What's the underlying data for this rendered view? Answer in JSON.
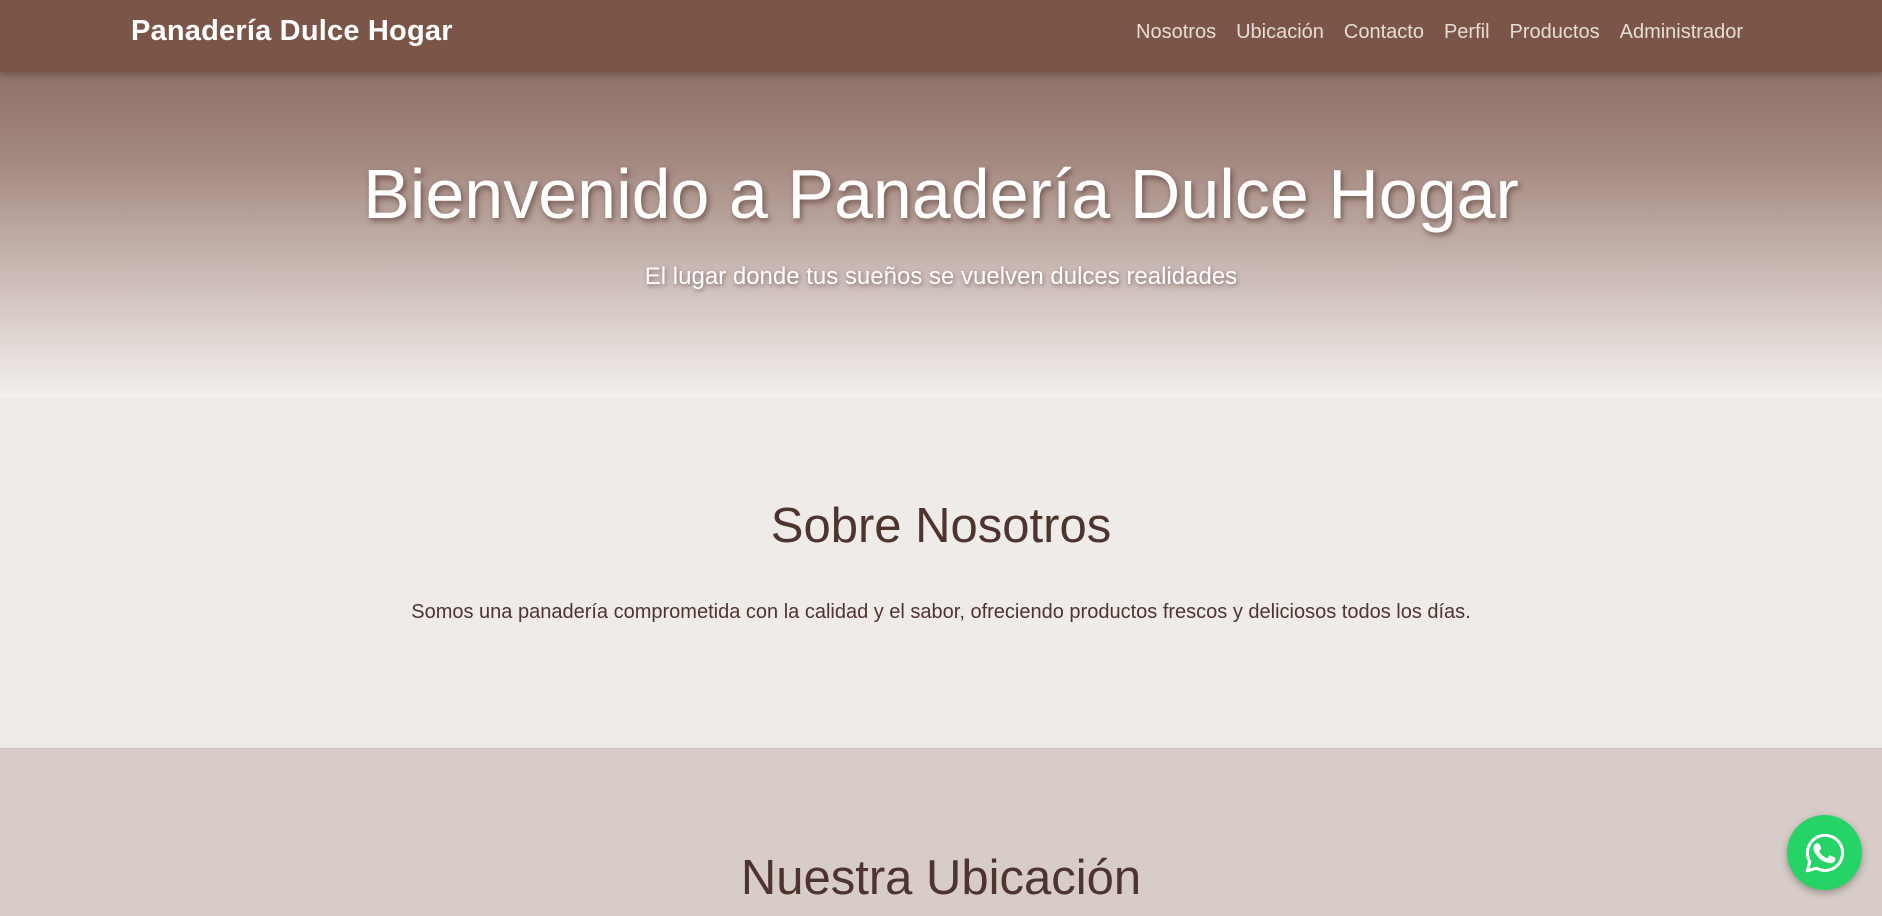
{
  "navbar": {
    "brand": "Panadería Dulce Hogar",
    "links": [
      {
        "label": "Nosotros"
      },
      {
        "label": "Ubicación"
      },
      {
        "label": "Contacto"
      },
      {
        "label": "Perfil"
      },
      {
        "label": "Productos"
      },
      {
        "label": "Administrador"
      }
    ]
  },
  "hero": {
    "title": "Bienvenido a Panadería Dulce Hogar",
    "subtitle": "El lugar donde tus sueños se vuelven dulces realidades"
  },
  "about": {
    "title": "Sobre Nosotros",
    "text": "Somos una panadería comprometida con la calidad y el sabor, ofreciendo productos frescos y deliciosos todos los días."
  },
  "location": {
    "title": "Nuestra Ubicación"
  },
  "whatsapp": {
    "icon": "whatsapp-icon"
  },
  "colors": {
    "navbar_bg": "#7a5548",
    "heading": "#4e342e",
    "about_bg": "#efebe8",
    "location_bg": "#d7ccc8",
    "whatsapp": "#25d366"
  }
}
